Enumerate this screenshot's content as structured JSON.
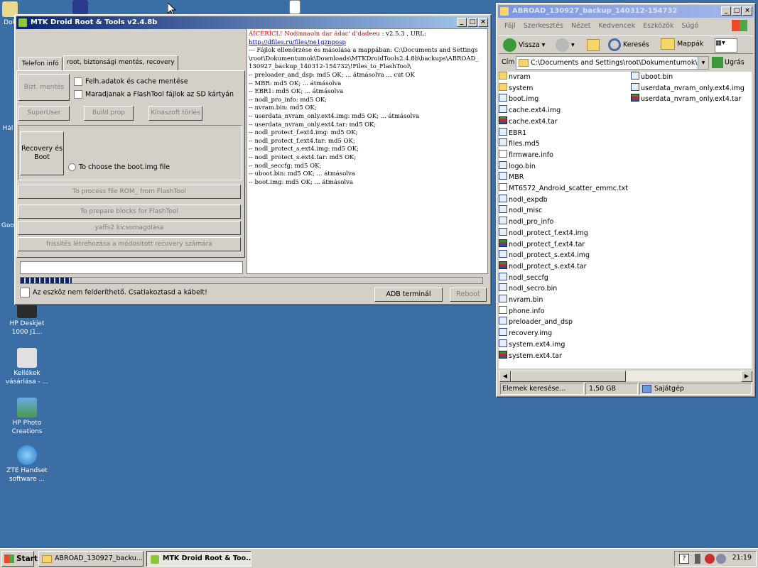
{
  "desktop": {
    "icons": [
      {
        "label": "Dok"
      },
      {
        "label": "Hál"
      },
      {
        "label": "Goo"
      },
      {
        "label": "HP Deskjet 1000 J1..."
      },
      {
        "label": "Kellékek vásárlása - ..."
      },
      {
        "label": "HP Photo Creations"
      },
      {
        "label": "ZTE Handset software ..."
      }
    ]
  },
  "mtk": {
    "title": "MTK Droid Root & Tools v2.4.8b",
    "tabs": [
      "Telefon infó",
      "root, biztonsági mentés, recovery"
    ],
    "backup_button": "Bizt. mentés",
    "check1": "Felh.adatok és cache mentése",
    "check2": "Maradjanak a FlashTool fájlok az SD kártyán",
    "superuser": "SuperUser",
    "buildprop": "Build.prop",
    "chinese_delete": "Kínaszoft törlés",
    "recovery_boot": "Recovery és Boot",
    "choose_boot": "To choose the boot.img file",
    "process_rom": "To process file ROM_ from FlashTool",
    "prepare_blocks": "To prepare blocks for FlashTool",
    "yaffs": "yaffs2 kicsomagolása",
    "update_recovery": "frissítés létrehozása a módosított recovery számára",
    "status": "Az eszköz nem felderíthető. Csatlakoztasd a kábelt!",
    "adb": "ADB terminál",
    "reboot": "Reboot",
    "log_header": "ÁÍCÉRÍCL! Nodinnaoln dar ádac' d'dadeeu",
    "log_version": " : v2.5.3 , URL:",
    "log_url": "http://dfiles.ru/files/ne1gznposp",
    "log_lines": [
      " --- Fájlok ellenőrzése és másolása a mappában: C:\\Documents and Settings",
      "\\root\\Dokumentumok\\Downloads\\MTKDroidTools2.4.8b\\backups\\ABROAD_",
      "130927_backup_140312-154732\\!Files_to_FlashTool\\",
      "  -- preloader_and_dsp: md5 OK;  ... átmásolva  ... cut OK",
      "  -- MBR: md5 OK;  ... átmásolva",
      "  -- EBR1: md5 OK;  ... átmásolva",
      "  -- nodl_pro_info: md5 OK;",
      "  -- nvram.bin: md5 OK;",
      "  -- userdata_nvram_only.ext4.img: md5 OK;  ... átmásolva",
      "  -- userdata_nvram_only.ext4.tar: md5 OK;",
      "  -- nodl_protect_f.ext4.img: md5 OK;",
      "  -- nodl_protect_f.ext4.tar: md5 OK;",
      "  -- nodl_protect_s.ext4.img: md5 OK;",
      "  -- nodl_protect_s.ext4.tar: md5 OK;",
      "  -- nodl_seccfg: md5 OK;",
      "  -- uboot.bin: md5 OK;  ... átmásolva",
      "  -- boot.img: md5 OK;  ... átmásolva"
    ]
  },
  "explorer": {
    "title": "ABROAD_130927_backup_140312-154732",
    "menu": [
      "Fájl",
      "Szerkesztés",
      "Nézet",
      "Kedvencek",
      "Eszközök",
      "Súgó"
    ],
    "back": "Vissza",
    "search": "Keresés",
    "folders": "Mappák",
    "address_label": "Cím",
    "address": "C:\\Documents and Settings\\root\\Dokumentumok\\Do",
    "go": "Ugrás",
    "col1": [
      {
        "name": "nvram",
        "type": "folder"
      },
      {
        "name": "system",
        "type": "folder"
      },
      {
        "name": "boot.img",
        "type": "file"
      },
      {
        "name": "cache.ext4.img",
        "type": "file"
      },
      {
        "name": "cache.ext4.tar",
        "type": "tar"
      },
      {
        "name": "EBR1",
        "type": "file"
      },
      {
        "name": "files.md5",
        "type": "file"
      },
      {
        "name": "firmware.info",
        "type": "txt"
      },
      {
        "name": "logo.bin",
        "type": "file"
      },
      {
        "name": "MBR",
        "type": "file"
      },
      {
        "name": "MT6572_Android_scatter_emmc.txt",
        "type": "txt"
      },
      {
        "name": "nodl_expdb",
        "type": "file"
      },
      {
        "name": "nodl_misc",
        "type": "file"
      },
      {
        "name": "nodl_pro_info",
        "type": "file"
      },
      {
        "name": "nodl_protect_f.ext4.img",
        "type": "file"
      },
      {
        "name": "nodl_protect_f.ext4.tar",
        "type": "tar"
      },
      {
        "name": "nodl_protect_s.ext4.img",
        "type": "file"
      },
      {
        "name": "nodl_protect_s.ext4.tar",
        "type": "tar"
      },
      {
        "name": "nodl_seccfg",
        "type": "file"
      },
      {
        "name": "nodl_secro.bin",
        "type": "file"
      },
      {
        "name": "nvram.bin",
        "type": "file"
      },
      {
        "name": "phone.info",
        "type": "txt"
      },
      {
        "name": "preloader_and_dsp",
        "type": "file"
      },
      {
        "name": "recovery.img",
        "type": "file"
      },
      {
        "name": "system.ext4.img",
        "type": "file"
      },
      {
        "name": "system.ext4.tar",
        "type": "tar"
      }
    ],
    "col2": [
      {
        "name": "uboot.bin",
        "type": "file"
      },
      {
        "name": "userdata_nvram_only.ext4.img",
        "type": "file"
      },
      {
        "name": "userdata_nvram_only.ext4.tar",
        "type": "tar"
      }
    ],
    "status_left": "Elemek keresése...",
    "status_size": "1,50 GB",
    "status_zone": "Sajátgép"
  },
  "taskbar": {
    "start": "Start",
    "item1": "ABROAD_130927_backu...",
    "item2": "MTK Droid Root & Too...",
    "clock": "21:19"
  }
}
